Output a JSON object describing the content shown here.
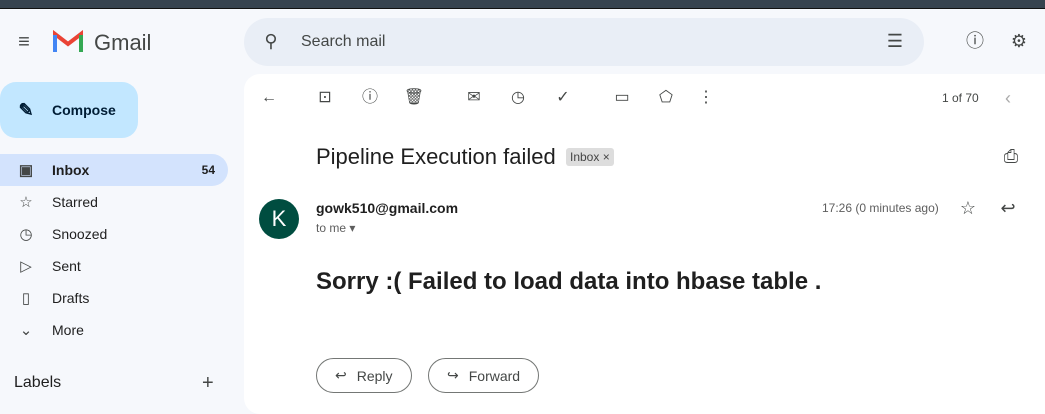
{
  "app": {
    "name": "Gmail"
  },
  "search": {
    "placeholder": "Search mail"
  },
  "compose": "Compose",
  "nav": [
    {
      "label": "Inbox",
      "count": "54",
      "icon": "inbox-icon",
      "g": "▣"
    },
    {
      "label": "Starred",
      "icon": "star-icon",
      "g": "☆"
    },
    {
      "label": "Snoozed",
      "icon": "clock-icon",
      "g": "◷"
    },
    {
      "label": "Sent",
      "icon": "send-icon",
      "g": "▷"
    },
    {
      "label": "Drafts",
      "icon": "draft-icon",
      "g": "▯"
    },
    {
      "label": "More",
      "icon": "chevron-down-icon",
      "g": "⌄"
    }
  ],
  "labels": {
    "title": "Labels",
    "add": "+"
  },
  "pager": "1 of 70",
  "email": {
    "subject": "Pipeline Execution failed",
    "tag": "Inbox",
    "sender": "gowk510@gmail.com",
    "avatar": "K",
    "to": "to me",
    "time": "17:26 (0 minutes ago)",
    "body": "Sorry :( Failed to load data into hbase table ."
  },
  "actions": {
    "reply": "Reply",
    "forward": "Forward"
  },
  "colors": {
    "accent": "#c2e7ff",
    "selected": "#d3e3fd",
    "avatar": "#004d40"
  }
}
